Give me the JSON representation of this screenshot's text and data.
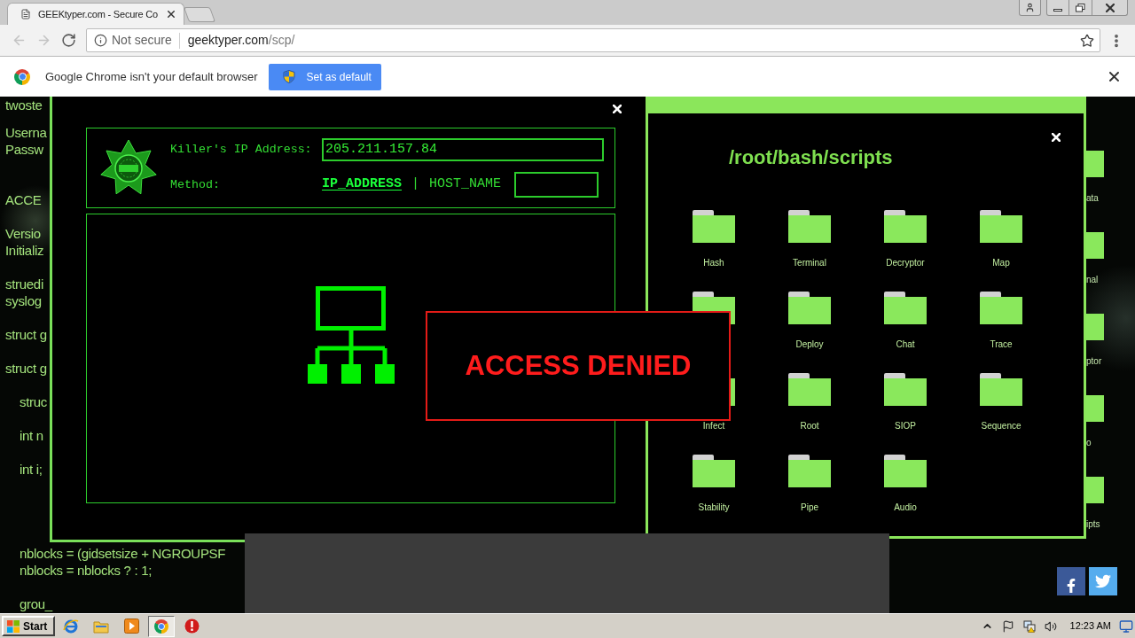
{
  "browser": {
    "tab": {
      "title": "GEEKtyper.com - Secure Co"
    },
    "nav_buttons": [
      {
        "kind": "back",
        "disabled": true
      },
      {
        "kind": "forward",
        "disabled": true
      },
      {
        "kind": "reload",
        "disabled": false
      }
    ],
    "address_bar": {
      "security": "Not secure",
      "host": "geektyper.com",
      "path": "/scp/"
    },
    "infobar": {
      "message": "Google Chrome isn't your default browser",
      "button": "Set as default"
    }
  },
  "terminal": {
    "blocks": [
      {
        "lines": [
          "twoste"
        ]
      },
      {
        "lines": [
          "Userna",
          "Passw"
        ]
      },
      {
        "lines": [
          "ACCE"
        ]
      },
      {
        "lines": [
          "Versio",
          "Initializ"
        ]
      },
      {
        "lines": [
          "struedi",
          "syslog"
        ]
      },
      {
        "lines": [
          "struct g"
        ]
      },
      {
        "lines": [
          "struct g"
        ],
        "children": [
          {
            "lines": [
              "struc"
            ]
          },
          {
            "lines": [
              "int n"
            ]
          },
          {
            "lines": [
              "int i;"
            ]
          },
          {
            "lines": [
              "nblocks = (gidsetsize + NGROUPSF",
              "nblocks = nblocks ? : 1;"
            ]
          },
          {
            "lines": [
              "grou_"
            ]
          }
        ]
      }
    ]
  },
  "desktop_fragments": [
    {
      "label": "ata"
    },
    {
      "label": "nal"
    },
    {
      "label": "ptor"
    },
    {
      "label": "o"
    },
    {
      "label": "ipts"
    }
  ],
  "trace_window": {
    "ip_label": "Killer's IP Address:",
    "ip_value": "205.211.157.84",
    "method_label": "Method:",
    "methods": [
      {
        "label": "IP_ADDRESS",
        "selected": true
      },
      {
        "label": "HOST_NAME",
        "selected": false
      }
    ],
    "separator": "|"
  },
  "access_alert": {
    "message": "ACCESS DENIED"
  },
  "scripts_window": {
    "title": "/root/bash/scripts",
    "folders": [
      {
        "kind": "folder",
        "label": "Hash"
      },
      {
        "kind": "folder",
        "label": "Terminal"
      },
      {
        "kind": "folder",
        "label": "Decryptor"
      },
      {
        "kind": "folder",
        "label": "Map"
      },
      {
        "kind": "folder"
      },
      {
        "kind": "folder",
        "label": "Deploy"
      },
      {
        "kind": "folder",
        "label": "Chat"
      },
      {
        "kind": "folder",
        "label": "Trace"
      },
      {
        "kind": "folder",
        "label": "Infect"
      },
      {
        "kind": "folder",
        "label": "Root"
      },
      {
        "kind": "folder",
        "label": "SIOP"
      },
      {
        "kind": "folder",
        "label": "Sequence"
      },
      {
        "kind": "folder",
        "label": "Stability"
      },
      {
        "kind": "folder",
        "label": "Pipe"
      },
      {
        "kind": "folder",
        "label": "Audio"
      }
    ]
  },
  "taskbar": {
    "start": "Start",
    "apps": [
      {
        "selected": false
      },
      {
        "selected": false
      },
      {
        "selected": false
      },
      {
        "selected": true
      },
      {
        "selected": false
      }
    ],
    "clock": "12:23 AM"
  }
}
